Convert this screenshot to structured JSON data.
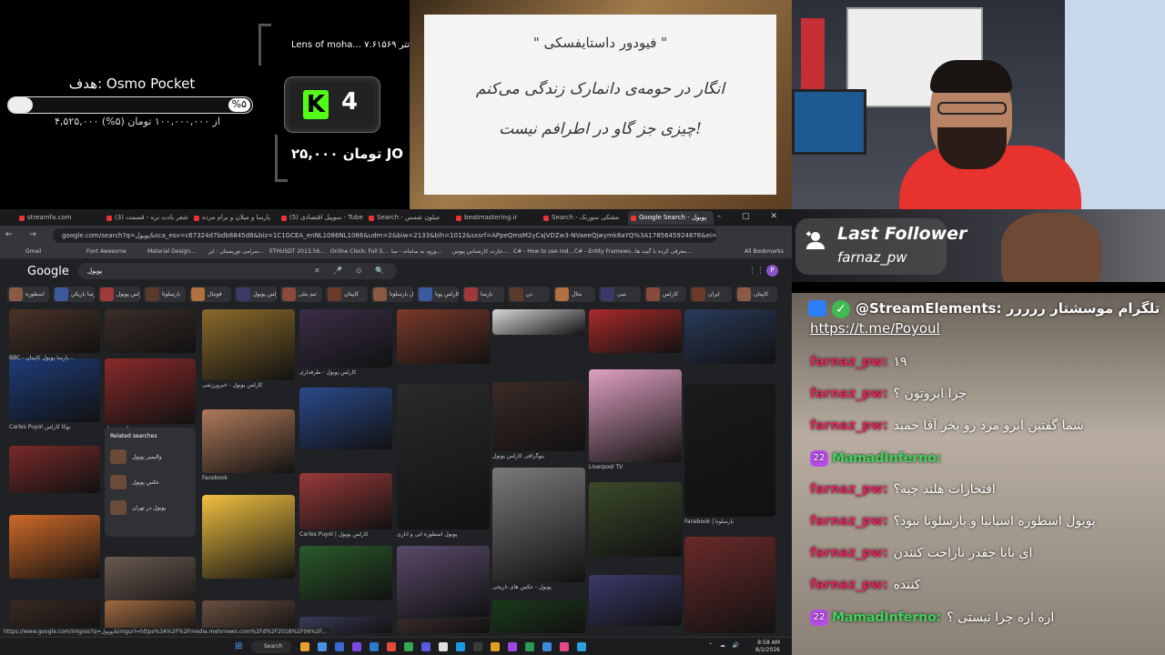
{
  "goal": {
    "title": "هدف: Osmo Pocket",
    "percent_label": "%۵",
    "progress_fraction": 0.05,
    "amount": "۴,۵۲۵,۰۰۰ از ۱۰۰,۰۰۰,۰۰۰ تومان (۵%)"
  },
  "kick": {
    "last_label": "Lens of moha... ۷.۶۱۵۶۹ تتر",
    "logo": "K",
    "count": "4",
    "bottom": "۲۵,۰۰۰ تومان JO"
  },
  "quote": {
    "title": "\" فیودور داستایفسکی \"",
    "line1": "انگار در حومه‌ی دانمارک زندگی می‌کنم",
    "line2": "چیزی جز گاو در اطرافم نیست!"
  },
  "follower": {
    "label": "Last Follower",
    "name": "farnaz_pw"
  },
  "chat": {
    "se_header": "@StreamElements: تلگرام موسشتار ررررر",
    "link": "https://t.me/Poyoul",
    "messages": [
      {
        "user": "farnaz_pw",
        "msg": "۱۹",
        "badge": ""
      },
      {
        "user": "farnaz_pw",
        "msg": "چرا ابروتون ؟",
        "badge": ""
      },
      {
        "user": "farnaz_pw",
        "msg": "شما گفتین ابرو مرد رو بخر آقا حمید",
        "badge": ""
      },
      {
        "user": "MamadInferno",
        "msg": "",
        "badge": "22"
      },
      {
        "user": "farnaz_pw",
        "msg": "افتخارات هلند چیه؟",
        "badge": ""
      },
      {
        "user": "farnaz_pw",
        "msg": "پویول اسطوره اسپانیا و بارسلونا نبود؟",
        "badge": ""
      },
      {
        "user": "farnaz_pw",
        "msg": "ای بابا چقدر ناراحت کنندن",
        "badge": ""
      },
      {
        "user": "farnaz_pw",
        "msg": "کننده",
        "badge": ""
      },
      {
        "user": "MamadInferno",
        "msg": "اره اره چرا نیستی ؟",
        "badge": "22"
      }
    ]
  },
  "browser": {
    "tabs": [
      {
        "label": "streamfa.com",
        "active": false
      },
      {
        "label": "(3) شعر یادت نره - قسمت",
        "active": false
      },
      {
        "label": "پارسا و میلان و برام مرده",
        "active": false
      },
      {
        "label": "(5) سوپیل اقتصادی - Tube",
        "active": false
      },
      {
        "label": "Search - میلون شمس",
        "active": false
      },
      {
        "label": "beatmastering.ir",
        "active": false
      },
      {
        "label": "Search - مشکی سورنک",
        "active": false
      },
      {
        "label": "Google Search - پویول",
        "active": true
      }
    ],
    "url": "google.com/search?q=پویول&sca_esv=c67324d7bdb8845d8&biz=1C1GCEA_enNL1086NL1086&udm=2&biw=2133&bih=1012&sxsrf=APpeQmsM2yCajVDZw3-NVaeeQjwymk8aYQ%3A1785645924876&ei=ZMtuao2CNaethbIP-bbhuQw&ved=0a...",
    "bookmarks": [
      "Gmail",
      "Font Awesome",
      "Material Design...",
      "سرامی توریستان : ایر...",
      "ETHUSDT 2013.56...",
      "Online Clock: Full S...",
      "ورود به سامانه - سا...",
      "جارت کارشناس پیوس...",
      "C# - How to use rod...",
      "C# - Entity Framewo...",
      "معرفی کرده با گیت ها...",
      "All Bookmarks"
    ],
    "search_query": "پویول",
    "google_logo": "Google",
    "profile_initial": "P",
    "chips": [
      "اسطوره",
      "بارسا بازیکن",
      "کارلس پویول",
      "بارسلونا",
      "فوتبال",
      "کارلس پویول",
      "تیم ملی",
      "کاپیتان",
      "پویول بارسلونا",
      "کارلس پویا",
      "بارسا",
      "دن",
      "مثال",
      "سی",
      "کارلس",
      "ایران",
      "کاپیتان"
    ],
    "related_title": "Related searches",
    "related": [
      "واليمير پويول",
      "عکس پویول",
      "پویول در تهران"
    ],
    "captions": [
      "BBC - بارسا پویول کاپیتان...",
      "Carles Puyol بوکا کارلس",
      "کارلس پویول - خبرورزشی",
      "Facebook",
      "کارلس پویول - طرفداری",
      "Carles Puyol | کارلس پویول",
      "پویول اسطوره آبی و اناری",
      "بیوگرافی کارلس پویول",
      "Liverpool TV",
      "Facebook | بارسلونا",
      "عکس پویول",
      "پویول - عکس های تاریخی"
    ],
    "status_url": "https://www.google.com/imgres?q=پویول&imgurl=https%3A%2F%2Fmedia.mehrnews.com%2Fd%2F2018%2F06%2F..."
  },
  "taskbar": {
    "search_label": "Search",
    "time": "8:58 AM",
    "date": "8/2/2026"
  },
  "colors": {
    "kick_green": "#53fc18",
    "chat_user": "#e0245e",
    "chat_user_green": "#3fd35a",
    "google_dark": "#202124"
  }
}
